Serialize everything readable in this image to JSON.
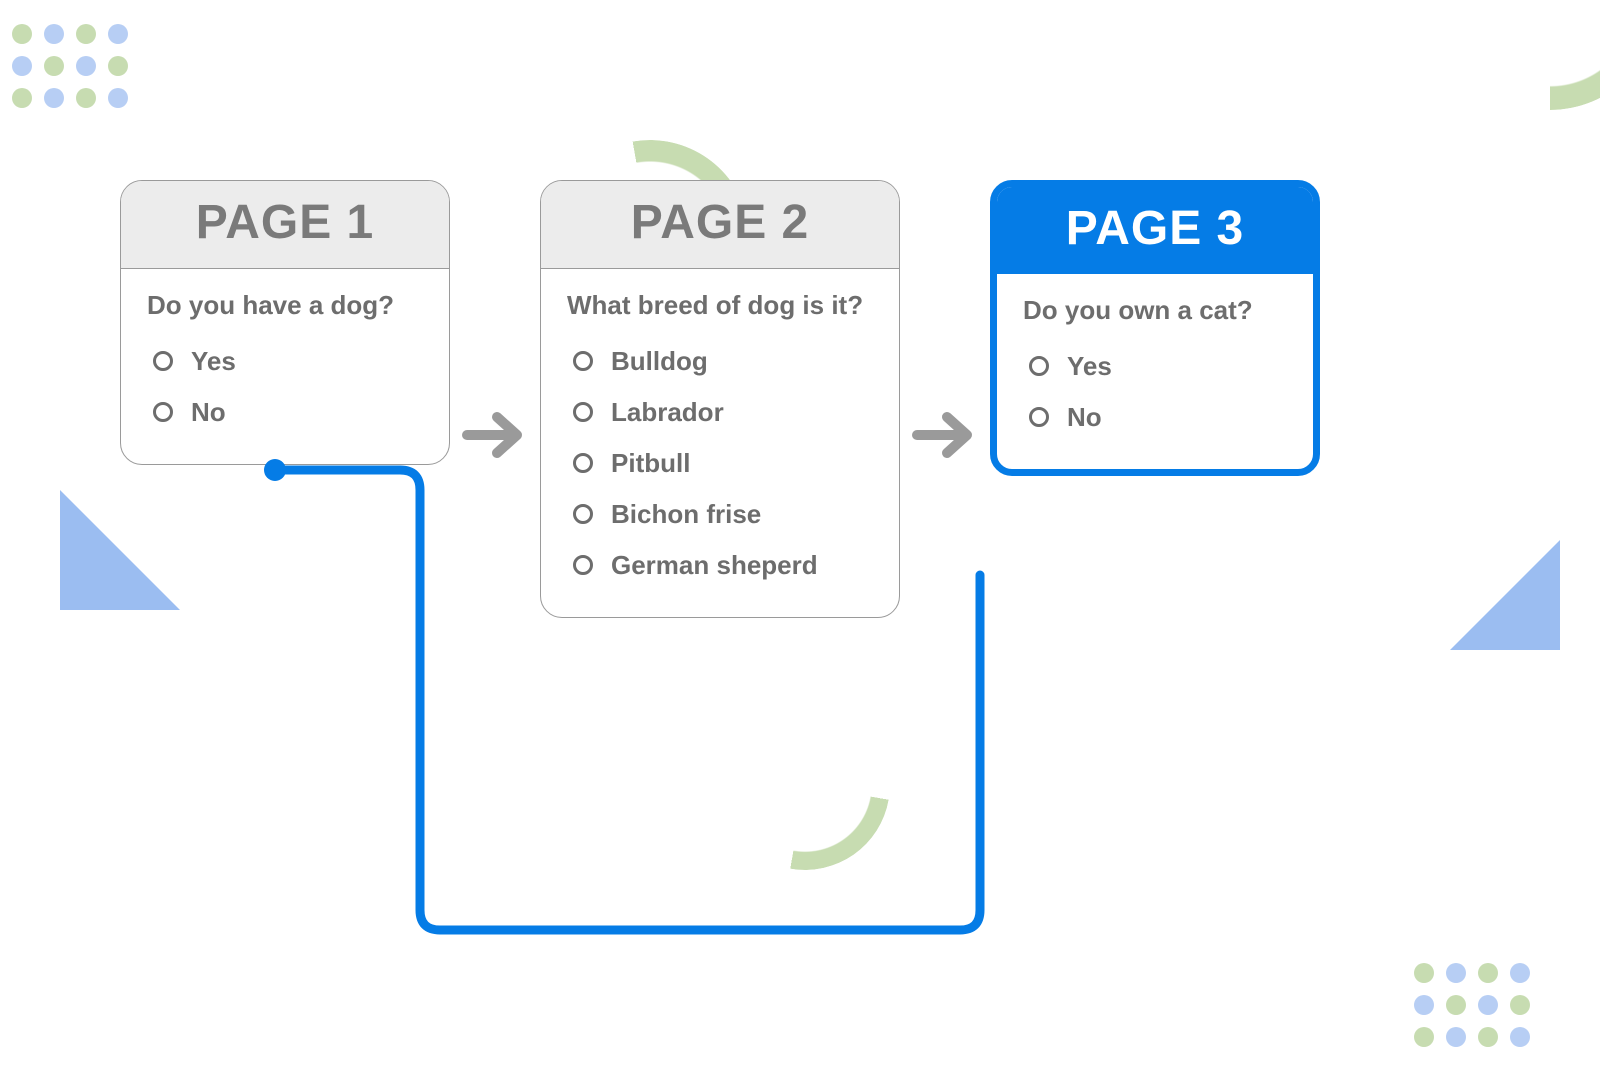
{
  "pages": [
    {
      "title": "PAGE 1",
      "question": "Do you have a dog?",
      "options": [
        "Yes",
        "No"
      ],
      "active": false
    },
    {
      "title": "PAGE 2",
      "question": "What breed of dog  is it?",
      "options": [
        "Bulldog",
        "Labrador",
        "Pitbull",
        "Bichon frise",
        "German sheperd"
      ],
      "active": false
    },
    {
      "title": "PAGE 3",
      "question": "Do you own a cat?",
      "options": [
        "Yes",
        "No"
      ],
      "active": true
    }
  ],
  "skip_logic": {
    "from_page": 1,
    "from_option_index": 1,
    "to_page": 3
  },
  "colors": {
    "accent_blue": "#057ce6",
    "light_blue": "#9bbdf1",
    "muted_green": "#c7dcb1",
    "card_border": "#9a9a9a",
    "text_muted": "#6d6d6d"
  }
}
